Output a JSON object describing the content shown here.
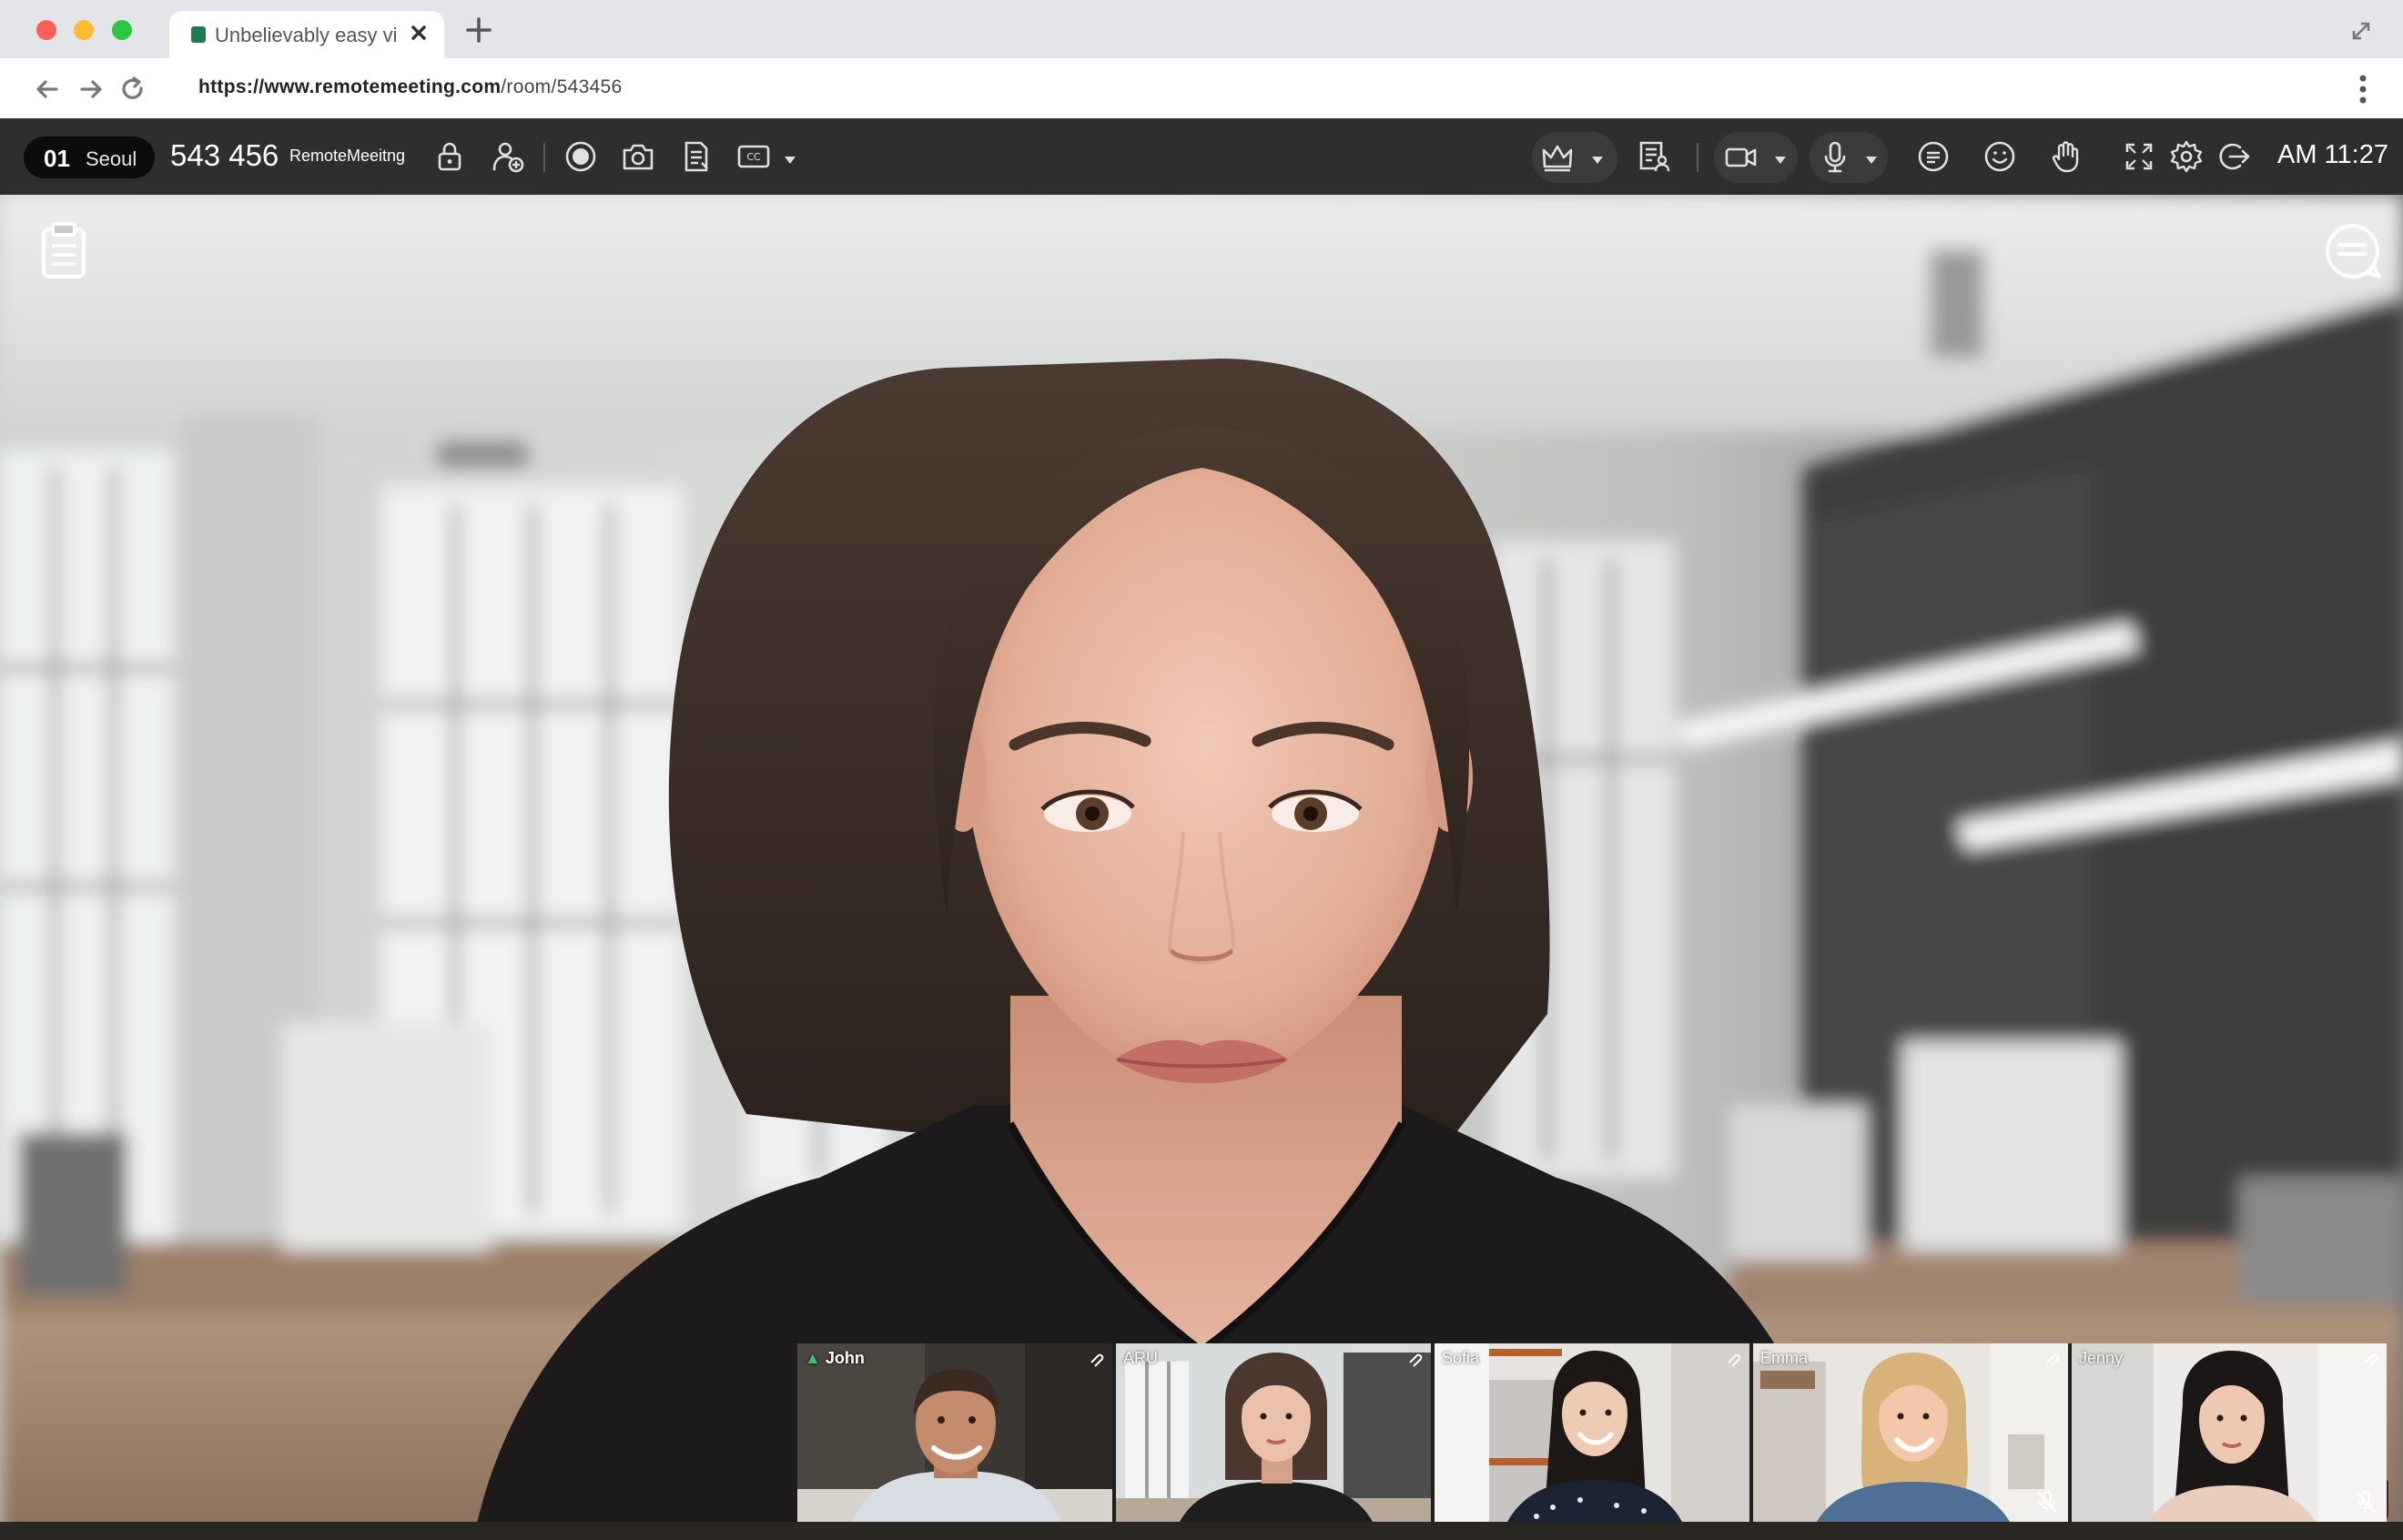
{
  "browser": {
    "tab_title": "Unbelievably easy vi...",
    "url_host": "https://www.remotemeeting.com",
    "url_path": "/room/543456"
  },
  "toolbar": {
    "location_number": "01",
    "location_city": "Seoul",
    "room_id": "543 456",
    "brand": "RemoteMeeitng",
    "time": "AM 11:27"
  },
  "participants": [
    {
      "name": "John",
      "host": true,
      "muted": false
    },
    {
      "name": "ARU",
      "host": false,
      "muted": false
    },
    {
      "name": "Sofia",
      "host": false,
      "muted": false
    },
    {
      "name": "Emma",
      "host": false,
      "muted": true
    },
    {
      "name": "Jenny",
      "host": false,
      "muted": true
    }
  ],
  "icons": {
    "toolbar_left": [
      "lock-icon",
      "add-user-icon",
      "record-icon",
      "camera-snapshot-icon",
      "document-icon",
      "closed-caption-icon"
    ],
    "toolbar_right": [
      "crown-icon",
      "presenter-list-icon",
      "video-camera-icon",
      "microphone-icon",
      "chat-icon",
      "emoji-icon",
      "raise-hand-icon",
      "fullscreen-icon",
      "settings-icon",
      "exit-icon"
    ],
    "main": [
      "notepad-icon",
      "chat-bubble-icon",
      "share-icon",
      "download-icon"
    ]
  },
  "colors": {
    "toolbar_bg": "#2e2e2e",
    "host_indicator": "#3cc36b",
    "traffic_red": "#fe5f57",
    "traffic_yellow": "#febc2e",
    "traffic_green": "#28c840"
  }
}
